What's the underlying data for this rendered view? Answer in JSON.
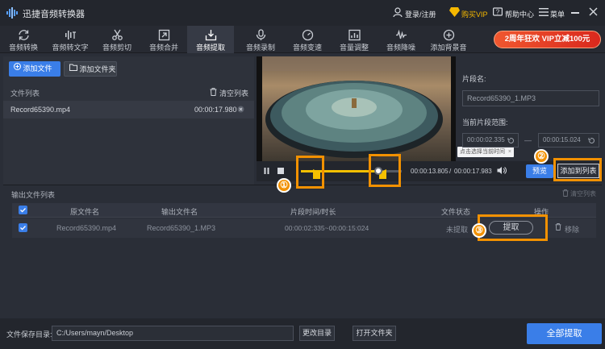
{
  "app": {
    "title": "迅捷音频转换器"
  },
  "header": {
    "login": "登录/注册",
    "buy": "购买VIP",
    "help": "帮助中心",
    "menu": "菜单"
  },
  "toolbar": {
    "items": [
      "音频转换",
      "音频转文字",
      "音频剪切",
      "音频合并",
      "音频提取",
      "音频录制",
      "音频变速",
      "音量调整",
      "音频降噪",
      "添加背景音"
    ],
    "active_index": 4,
    "promo": "2周年狂欢 VIP立减100元"
  },
  "left_panel": {
    "add_file": "添加文件",
    "add_folder": "添加文件夹",
    "file_list_label": "文件列表",
    "clear_list": "清空列表",
    "files": [
      {
        "name": "Record65390.mp4",
        "duration": "00:00:17.980"
      }
    ]
  },
  "player": {
    "current_time": "00:00:13.805",
    "total_time": "00:00:17.983",
    "tooltip": "点击选择当前时间",
    "preview": "预览",
    "add_to_list": "添加到列表",
    "progress": 0.768,
    "range_start": 0.13,
    "range_end": 0.836
  },
  "segment": {
    "name_label": "片段名:",
    "name_value": "Record65390_1.MP3",
    "range_label": "当前片段范围:",
    "start": "00:00:02.335",
    "end": "00:00:15.024",
    "dash": "—"
  },
  "output": {
    "label": "输出文件列表",
    "clear": "清空列表",
    "columns": [
      "原文件名",
      "输出文件名",
      "片段时间/时长",
      "文件状态",
      "操作"
    ],
    "rows": [
      {
        "src": "Record65390.mp4",
        "out": "Record65390_1.MP3",
        "time": "00:00:02:335~00:00:15:024",
        "status": "未提取",
        "action": "提取",
        "remove": "移除"
      }
    ]
  },
  "annotations": {
    "one": "①",
    "two": "②",
    "three": "③"
  },
  "footer": {
    "save_label": "文件保存目录:",
    "path": "C:/Users/mayn/Desktop",
    "change_dir": "更改目录",
    "open_folder": "打开文件夹",
    "extract_all": "全部提取"
  },
  "colors": {
    "accent": "#3a7ee8",
    "annotation": "#f29100",
    "marker": "#f5c000",
    "promo": "#e8402a"
  }
}
